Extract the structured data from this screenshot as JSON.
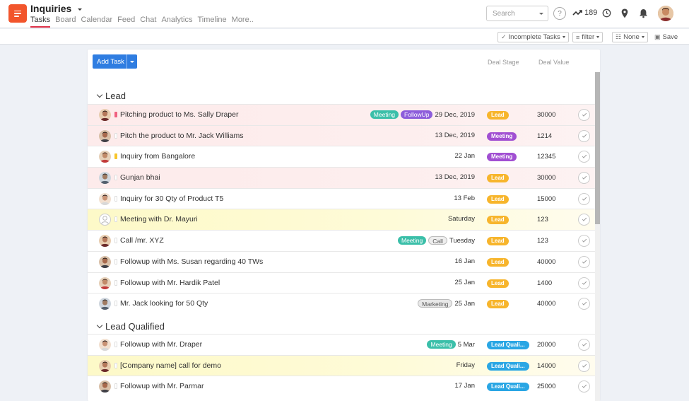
{
  "header": {
    "title": "Inquiries",
    "tabs": [
      {
        "label": "Tasks",
        "active": true
      },
      {
        "label": "Board"
      },
      {
        "label": "Calendar"
      },
      {
        "label": "Feed"
      },
      {
        "label": "Chat"
      },
      {
        "label": "Analytics"
      },
      {
        "label": "Timeline"
      },
      {
        "label": "More.."
      }
    ],
    "search_placeholder": "Search",
    "help_label": "?",
    "karma_count": "189"
  },
  "toolbar": {
    "incomplete_tasks": "Incomplete Tasks",
    "filter": "filter",
    "none": "None",
    "save": "Save"
  },
  "panel": {
    "add_task": "Add Task",
    "col_deal_stage": "Deal Stage",
    "col_deal_value": "Deal Value"
  },
  "groups": [
    {
      "name": "Lead",
      "rows": [
        {
          "task": "Pitching product to Ms. Sally Draper",
          "tags": [
            "Meeting",
            "FollowUp"
          ],
          "date": "29 Dec, 2019",
          "stage": "Lead",
          "value": "30000",
          "bg": "pink",
          "prio": "red"
        },
        {
          "task": "Pitch the product to Mr. Jack Williams",
          "tags": [],
          "date": "13 Dec, 2019",
          "stage": "Meeting",
          "value": "1214",
          "bg": "pink",
          "prio": "none"
        },
        {
          "task": "Inquiry from Bangalore",
          "tags": [],
          "date": "22 Jan",
          "stage": "Meeting",
          "value": "12345",
          "bg": "white",
          "prio": "yellow"
        },
        {
          "task": "Gunjan bhai",
          "tags": [],
          "date": "13 Dec, 2019",
          "stage": "Lead",
          "value": "30000",
          "bg": "pink",
          "prio": "none"
        },
        {
          "task": "Inquiry for 30 Qty of Product T5",
          "tags": [],
          "date": "13 Feb",
          "stage": "Lead",
          "value": "15000",
          "bg": "white",
          "prio": "none"
        },
        {
          "task": "Meeting with Dr. Mayuri",
          "tags": [],
          "date": "Saturday",
          "stage": "Lead",
          "value": "123",
          "bg": "yellow",
          "prio": "none"
        },
        {
          "task": "Call /mr. XYZ",
          "tags": [
            "Meeting",
            "Call"
          ],
          "date": "Tuesday",
          "stage": "Lead",
          "value": "123",
          "bg": "white",
          "prio": "none"
        },
        {
          "task": "Followup with Ms. Susan regarding 40 TWs",
          "tags": [],
          "date": "16 Jan",
          "stage": "Lead",
          "value": "40000",
          "bg": "white",
          "prio": "none"
        },
        {
          "task": "Followup with Mr. Hardik Patel",
          "tags": [],
          "date": "25 Jan",
          "stage": "Lead",
          "value": "1400",
          "bg": "white",
          "prio": "none"
        },
        {
          "task": "Mr. Jack looking for 50 Qty",
          "tags": [
            "Marketing"
          ],
          "date": "25 Jan",
          "stage": "Lead",
          "value": "40000",
          "bg": "white",
          "prio": "none"
        }
      ]
    },
    {
      "name": "Lead Qualified",
      "rows": [
        {
          "task": "Followup with Mr. Draper",
          "tags": [
            "Meeting"
          ],
          "date": "5 Mar",
          "stage": "Lead Quali...",
          "value": "20000",
          "bg": "white",
          "prio": "none"
        },
        {
          "task": "[Company name] call for demo",
          "tags": [],
          "date": "Friday",
          "stage": "Lead Quali...",
          "value": "14000",
          "bg": "yellow",
          "prio": "none"
        },
        {
          "task": "Followup with Mr. Parmar",
          "tags": [],
          "date": "17 Jan",
          "stage": "Lead Quali...",
          "value": "25000",
          "bg": "white",
          "prio": "none"
        }
      ]
    }
  ],
  "colors": {
    "accent": "#2f7de1",
    "logo": "#f2552c",
    "active_tab": "#e0344b",
    "stage_lead": "#f7b52c",
    "stage_meeting": "#a14fd2",
    "stage_qualified": "#29a6e4"
  }
}
